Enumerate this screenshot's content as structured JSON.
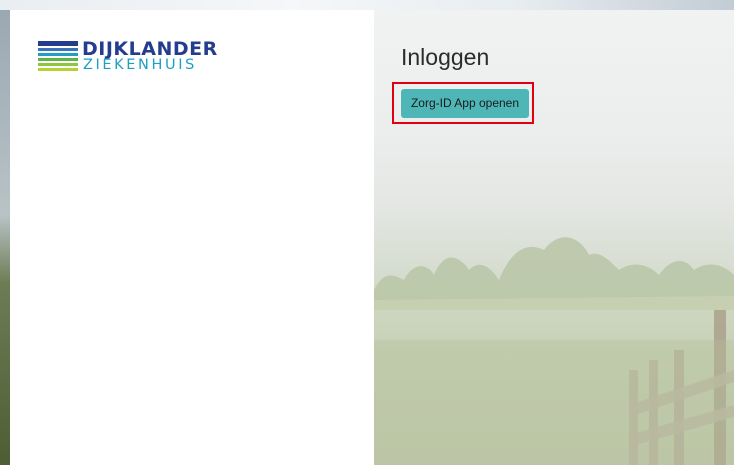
{
  "brand": {
    "name_line1": "DIJKLANDER",
    "name_line2": "ZIEKENHUIS",
    "colors": {
      "primary": "#253d8e",
      "secondary": "#1e9fc4",
      "green": "#8dc63f"
    }
  },
  "login": {
    "title": "Inloggen",
    "app_button_label": "Zorg-ID App openen",
    "button_color": "#4fb6b8",
    "highlight_color": "#e1000f"
  }
}
